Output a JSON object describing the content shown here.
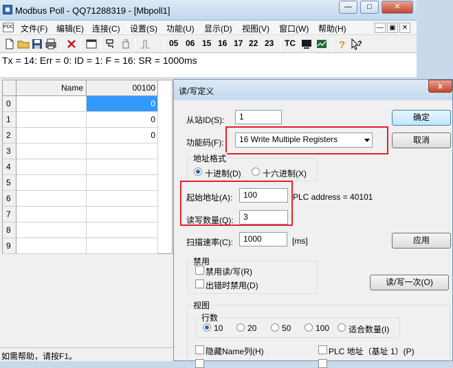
{
  "main_window": {
    "title": "Modbus Poll - QQ71288319 - [Mbpoll1]",
    "menu": [
      "文件(F)",
      "编辑(E)",
      "连接(C)",
      "设置(S)",
      "功能(U)",
      "显示(D)",
      "视图(V)",
      "窗口(W)",
      "帮助(H)"
    ],
    "toolbar_codes": [
      "05",
      "06",
      "15",
      "16",
      "17",
      "22",
      "23"
    ],
    "toolbar_tc": "TC",
    "status_line": "Tx = 14: Err = 0: ID = 1: F = 16: SR = 1000ms",
    "statusbar": "如需帮助，请按F1。"
  },
  "grid": {
    "header_name": "Name",
    "header_addr": "00100",
    "rows": [
      {
        "num": "0",
        "name": "",
        "value": "0"
      },
      {
        "num": "1",
        "name": "",
        "value": "0"
      },
      {
        "num": "2",
        "name": "",
        "value": "0"
      },
      {
        "num": "3",
        "name": "",
        "value": ""
      },
      {
        "num": "4",
        "name": "",
        "value": ""
      },
      {
        "num": "5",
        "name": "",
        "value": ""
      },
      {
        "num": "6",
        "name": "",
        "value": ""
      },
      {
        "num": "7",
        "name": "",
        "value": ""
      },
      {
        "num": "8",
        "name": "",
        "value": ""
      },
      {
        "num": "9",
        "name": "",
        "value": ""
      }
    ]
  },
  "dialog": {
    "title": "读/写定义",
    "close": "x",
    "slave_id_label": "从站ID(S):",
    "slave_id_value": "1",
    "function_label": "功能码(F):",
    "function_value": "16 Write Multiple Registers",
    "ok": "确定",
    "cancel": "取消",
    "address_format": {
      "title": "地址格式",
      "decimal": "十进制(D)",
      "hex": "十六进制(X)"
    },
    "start_address_label": "起始地址(A):",
    "start_address_value": "100",
    "plc_address": "PLC address = 40101",
    "quantity_label": "读写数量(Q):",
    "quantity_value": "3",
    "scan_rate_label": "扫描速率(C):",
    "scan_rate_value": "1000",
    "scan_rate_unit": "[ms]",
    "apply": "应用",
    "disable": {
      "title": "禁用",
      "rw_disabled": "禁用读/写(R)",
      "on_error": "出错时禁用(D)"
    },
    "read_write_once": "读/写一次(O)",
    "view": {
      "title": "视图",
      "rows_title": "行数",
      "rows_options": [
        "10",
        "20",
        "50",
        "100",
        "适合数量(I)"
      ],
      "hide_name": "隐藏Name列(H)",
      "plc_base1": "PLC 地址（基址 1）(P)"
    }
  }
}
